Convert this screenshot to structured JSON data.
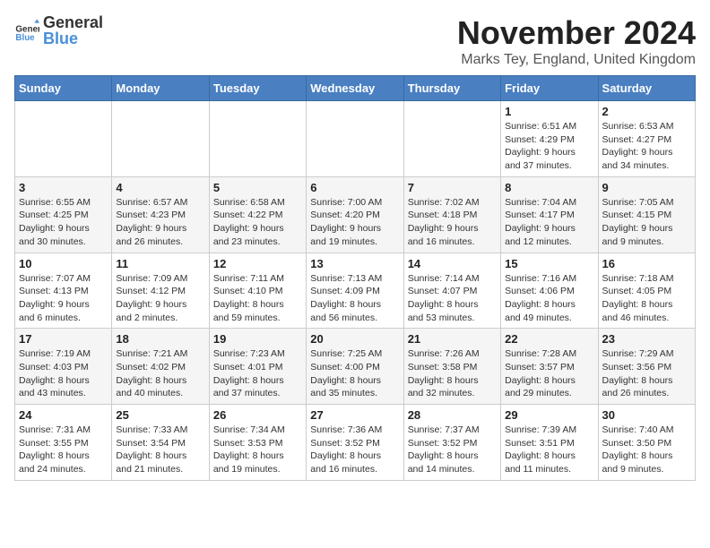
{
  "logo": {
    "text_general": "General",
    "text_blue": "Blue"
  },
  "header": {
    "month_year": "November 2024",
    "location": "Marks Tey, England, United Kingdom"
  },
  "weekdays": [
    "Sunday",
    "Monday",
    "Tuesday",
    "Wednesday",
    "Thursday",
    "Friday",
    "Saturday"
  ],
  "weeks": [
    [
      {
        "day": "",
        "info": ""
      },
      {
        "day": "",
        "info": ""
      },
      {
        "day": "",
        "info": ""
      },
      {
        "day": "",
        "info": ""
      },
      {
        "day": "",
        "info": ""
      },
      {
        "day": "1",
        "info": "Sunrise: 6:51 AM\nSunset: 4:29 PM\nDaylight: 9 hours\nand 37 minutes."
      },
      {
        "day": "2",
        "info": "Sunrise: 6:53 AM\nSunset: 4:27 PM\nDaylight: 9 hours\nand 34 minutes."
      }
    ],
    [
      {
        "day": "3",
        "info": "Sunrise: 6:55 AM\nSunset: 4:25 PM\nDaylight: 9 hours\nand 30 minutes."
      },
      {
        "day": "4",
        "info": "Sunrise: 6:57 AM\nSunset: 4:23 PM\nDaylight: 9 hours\nand 26 minutes."
      },
      {
        "day": "5",
        "info": "Sunrise: 6:58 AM\nSunset: 4:22 PM\nDaylight: 9 hours\nand 23 minutes."
      },
      {
        "day": "6",
        "info": "Sunrise: 7:00 AM\nSunset: 4:20 PM\nDaylight: 9 hours\nand 19 minutes."
      },
      {
        "day": "7",
        "info": "Sunrise: 7:02 AM\nSunset: 4:18 PM\nDaylight: 9 hours\nand 16 minutes."
      },
      {
        "day": "8",
        "info": "Sunrise: 7:04 AM\nSunset: 4:17 PM\nDaylight: 9 hours\nand 12 minutes."
      },
      {
        "day": "9",
        "info": "Sunrise: 7:05 AM\nSunset: 4:15 PM\nDaylight: 9 hours\nand 9 minutes."
      }
    ],
    [
      {
        "day": "10",
        "info": "Sunrise: 7:07 AM\nSunset: 4:13 PM\nDaylight: 9 hours\nand 6 minutes."
      },
      {
        "day": "11",
        "info": "Sunrise: 7:09 AM\nSunset: 4:12 PM\nDaylight: 9 hours\nand 2 minutes."
      },
      {
        "day": "12",
        "info": "Sunrise: 7:11 AM\nSunset: 4:10 PM\nDaylight: 8 hours\nand 59 minutes."
      },
      {
        "day": "13",
        "info": "Sunrise: 7:13 AM\nSunset: 4:09 PM\nDaylight: 8 hours\nand 56 minutes."
      },
      {
        "day": "14",
        "info": "Sunrise: 7:14 AM\nSunset: 4:07 PM\nDaylight: 8 hours\nand 53 minutes."
      },
      {
        "day": "15",
        "info": "Sunrise: 7:16 AM\nSunset: 4:06 PM\nDaylight: 8 hours\nand 49 minutes."
      },
      {
        "day": "16",
        "info": "Sunrise: 7:18 AM\nSunset: 4:05 PM\nDaylight: 8 hours\nand 46 minutes."
      }
    ],
    [
      {
        "day": "17",
        "info": "Sunrise: 7:19 AM\nSunset: 4:03 PM\nDaylight: 8 hours\nand 43 minutes."
      },
      {
        "day": "18",
        "info": "Sunrise: 7:21 AM\nSunset: 4:02 PM\nDaylight: 8 hours\nand 40 minutes."
      },
      {
        "day": "19",
        "info": "Sunrise: 7:23 AM\nSunset: 4:01 PM\nDaylight: 8 hours\nand 37 minutes."
      },
      {
        "day": "20",
        "info": "Sunrise: 7:25 AM\nSunset: 4:00 PM\nDaylight: 8 hours\nand 35 minutes."
      },
      {
        "day": "21",
        "info": "Sunrise: 7:26 AM\nSunset: 3:58 PM\nDaylight: 8 hours\nand 32 minutes."
      },
      {
        "day": "22",
        "info": "Sunrise: 7:28 AM\nSunset: 3:57 PM\nDaylight: 8 hours\nand 29 minutes."
      },
      {
        "day": "23",
        "info": "Sunrise: 7:29 AM\nSunset: 3:56 PM\nDaylight: 8 hours\nand 26 minutes."
      }
    ],
    [
      {
        "day": "24",
        "info": "Sunrise: 7:31 AM\nSunset: 3:55 PM\nDaylight: 8 hours\nand 24 minutes."
      },
      {
        "day": "25",
        "info": "Sunrise: 7:33 AM\nSunset: 3:54 PM\nDaylight: 8 hours\nand 21 minutes."
      },
      {
        "day": "26",
        "info": "Sunrise: 7:34 AM\nSunset: 3:53 PM\nDaylight: 8 hours\nand 19 minutes."
      },
      {
        "day": "27",
        "info": "Sunrise: 7:36 AM\nSunset: 3:52 PM\nDaylight: 8 hours\nand 16 minutes."
      },
      {
        "day": "28",
        "info": "Sunrise: 7:37 AM\nSunset: 3:52 PM\nDaylight: 8 hours\nand 14 minutes."
      },
      {
        "day": "29",
        "info": "Sunrise: 7:39 AM\nSunset: 3:51 PM\nDaylight: 8 hours\nand 11 minutes."
      },
      {
        "day": "30",
        "info": "Sunrise: 7:40 AM\nSunset: 3:50 PM\nDaylight: 8 hours\nand 9 minutes."
      }
    ]
  ]
}
